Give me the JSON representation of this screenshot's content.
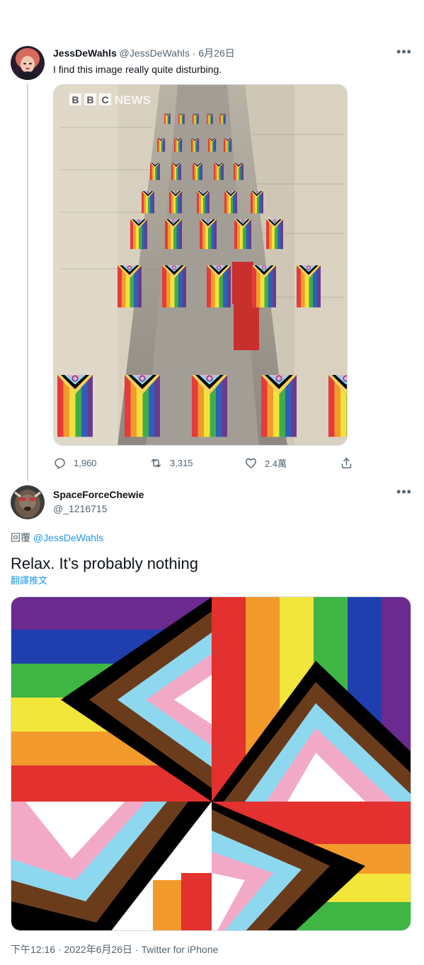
{
  "tweet1": {
    "display_name": "JessDeWahls",
    "handle": "@JessDeWahls",
    "separator": " · ",
    "date": "6月26日",
    "text": "I find this image really quite disturbing.",
    "image_watermark": "BBC NEWS",
    "replies": "1,960",
    "retweets": "3,315",
    "likes": "2.4萬"
  },
  "tweet2": {
    "display_name": "SpaceForceChewie",
    "handle": "@_1216715",
    "replying_prefix": "回覆 ",
    "replying_to": "@JessDeWahls",
    "text": "Relax. It’s probably nothing",
    "translate_label": "翻譯推文",
    "time": "下午12:16",
    "sep": " · ",
    "date": "2022年6月26日",
    "source": "Twitter for iPhone"
  },
  "icons": {
    "more": "more-options-icon",
    "reply": "reply-icon",
    "retweet": "retweet-icon",
    "like": "heart-icon",
    "share": "share-icon"
  },
  "colors": {
    "link": "#1d9bf0",
    "secondary": "#536471",
    "text": "#0f1419",
    "border": "#cfd9de"
  }
}
